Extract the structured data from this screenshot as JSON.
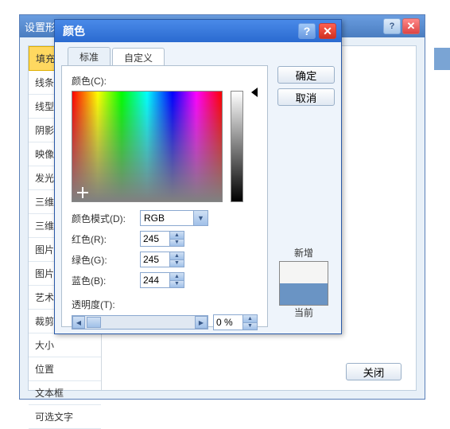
{
  "bg_dialog": {
    "title": "设置形",
    "close_button": "关闭",
    "sidebar": {
      "items": [
        "填充",
        "线条颜",
        "线型",
        "阴影",
        "映像",
        "发光和",
        "三维格",
        "三维旋",
        "图片更",
        "图片颜",
        "艺术效",
        "裁剪",
        "大小",
        "位置",
        "文本框",
        "可选文字"
      ],
      "active_index": 0
    }
  },
  "fg_dialog": {
    "title": "颜色",
    "ok": "确定",
    "cancel": "取消",
    "tabs": {
      "standard": "标准",
      "custom": "自定义",
      "active": "custom"
    },
    "color_label": "颜色(C):",
    "mode_label": "颜色模式(D):",
    "mode_value": "RGB",
    "red_label": "红色(R):",
    "green_label": "绿色(G):",
    "blue_label": "蓝色(B):",
    "red": "245",
    "green": "245",
    "blue": "244",
    "transparency_label": "透明度(T):",
    "transparency_value": "0 %",
    "preview": {
      "new_label": "新增",
      "current_label": "当前"
    }
  }
}
